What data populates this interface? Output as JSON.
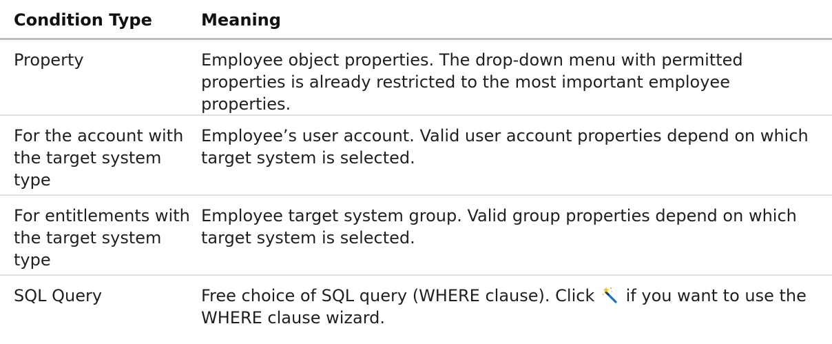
{
  "table": {
    "headers": {
      "condition_type": "Condition Type",
      "meaning": "Meaning"
    },
    "rows": [
      {
        "condition_type": "Property",
        "meaning": "Employee object properties. The drop-down menu with permitted properties is already restricted to the most important employee properties."
      },
      {
        "condition_type": "For the account with the target system type",
        "meaning": "Employee’s user account. Valid user account properties depend on which target system is selected."
      },
      {
        "condition_type": "For entitlements with the target system type",
        "meaning": "Employee target system group. Valid group properties depend on which target system is selected."
      },
      {
        "condition_type": "SQL Query",
        "meaning_before_icon": "Free choice of SQL query (WHERE clause). Click",
        "meaning_icon": "magic-wand-icon",
        "meaning_after_icon": "if you want to use the WHERE clause wizard."
      }
    ]
  }
}
